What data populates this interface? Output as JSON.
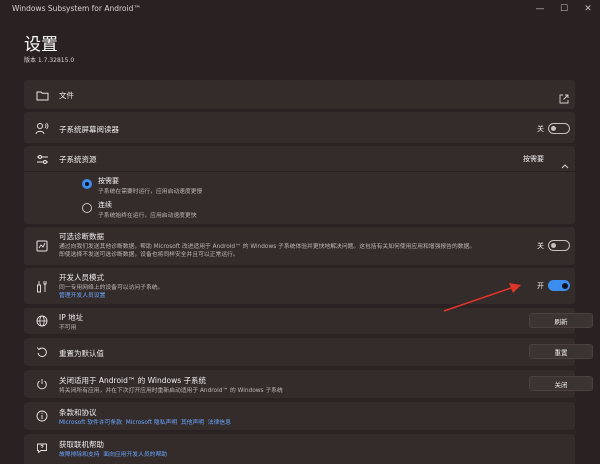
{
  "window": {
    "title": "Windows Subsystem for Android™",
    "minimize_glyph": "—",
    "maximize_glyph": "☐",
    "close_glyph": "✕"
  },
  "header": {
    "title": "设置",
    "version": "版本 1.7.32815.0"
  },
  "files": {
    "label": "文件",
    "icon": "folder-icon",
    "action_icon": "open-external-icon"
  },
  "screen_reader": {
    "label": "子系统屏幕阅读器",
    "toggle_label": "关",
    "state": "off",
    "icon": "person-voice-icon"
  },
  "resources": {
    "label": "子系统资源",
    "value": "按需要",
    "expanded": true,
    "icon": "sliders-icon",
    "options": [
      {
        "label": "按需要",
        "desc": "子系统在需要时运行，应用启动速度更慢",
        "selected": true
      },
      {
        "label": "连续",
        "desc": "子系统始终在运行，应用启动速度更快",
        "selected": false
      }
    ]
  },
  "diagnostics": {
    "label": "可选诊断数据",
    "desc1": "通过向我们发送其他诊断数据，帮助 Microsoft 改进适用于 Android™ 的 Windows 子系统体验并更快地解决问题。这包括有关如何使用应用和增强报告的数据。",
    "desc2": "即使选择不发送可选诊断数据，设备也将同样安全并且可以正常运行。",
    "toggle_label": "关",
    "state": "off",
    "icon": "diagnostics-icon"
  },
  "developer": {
    "label": "开发人员模式",
    "desc": "同一专用网络上的设备可以访问子系统。",
    "link": "管理开发人员设置",
    "toggle_label": "开",
    "state": "on",
    "icon": "dev-tools-icon"
  },
  "ip": {
    "label": "IP 地址",
    "value": "不可用",
    "button": "刷新",
    "icon": "globe-icon"
  },
  "reset": {
    "label": "重置为默认值",
    "button": "重置",
    "icon": "reset-icon"
  },
  "shutdown": {
    "label": "关闭适用于 Android™ 的 Windows 子系统",
    "desc": "将关闭所有应用，并在下次打开应用时重新启动适用于 Android™ 的 Windows 子系统",
    "button": "关闭",
    "icon": "power-icon"
  },
  "terms": {
    "label": "条款和协议",
    "links": [
      "Microsoft 软件许可条款",
      "Microsoft 隐私声明",
      "其他声明",
      "法律信息"
    ],
    "icon": "info-icon"
  },
  "help": {
    "label": "获取联机帮助",
    "links": [
      "故障排除和支持",
      "面向应用开发人员的帮助"
    ],
    "icon": "help-icon"
  },
  "colors": {
    "accent": "#3b8ef0",
    "arrow": "#e0342b",
    "link": "#6ba8ff"
  }
}
